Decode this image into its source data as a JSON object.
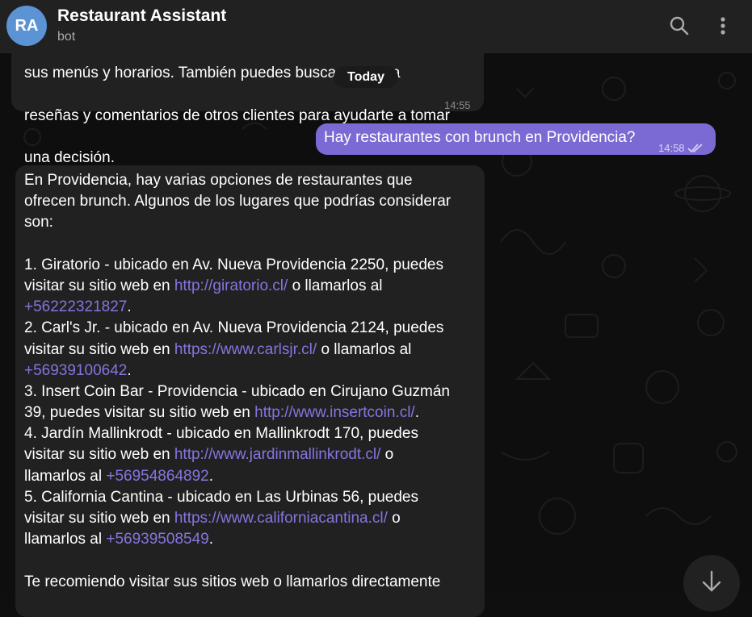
{
  "header": {
    "avatar_initials": "RA",
    "title": "Restaurant Assistant",
    "subtitle": "bot",
    "search_icon": "search-icon",
    "menu_icon": "more-vertical-icon"
  },
  "date_separator": "Today",
  "messages": {
    "msg1": {
      "lines": [
        "sus menús y horarios. También puedes buscar en línea",
        "reseñas y comentarios de otros clientes para ayudarte a tomar",
        "una decisión."
      ],
      "time": "14:55"
    },
    "msg2": {
      "text": "Hay restaurantes con brunch en Providencia?",
      "time": "14:58",
      "status_icon": "double-check-icon"
    },
    "msg3": {
      "intro": [
        "En Providencia, hay varias opciones de restaurantes que",
        "ofrecen brunch. Algunos de los lugares que podrías considerar",
        "son:"
      ],
      "items": {
        "i1": {
          "l1": "1. Giratorio - ubicado en Av. Nueva Providencia 2250, puedes",
          "l2a": "visitar su sitio web en ",
          "link": "http://giratorio.cl/",
          "l2b": " o llamarlos al",
          "phone": "+56222321827",
          "l3b": "."
        },
        "i2": {
          "l1": "2. Carl's Jr. - ubicado en Av. Nueva Providencia 2124, puedes",
          "l2a": "visitar su sitio web en ",
          "link": "https://www.carlsjr.cl/",
          "l2b": " o llamarlos al",
          "phone": "+56939100642",
          "l3b": "."
        },
        "i3": {
          "l1": "3. Insert Coin Bar - Providencia - ubicado en Cirujano Guzmán",
          "l2a": "39, puedes visitar su sitio web en ",
          "link": "http://www.insertcoin.cl/",
          "l2b": "."
        },
        "i4": {
          "l1": "4. Jardín Mallinkrodt - ubicado en Mallinkrodt 170, puedes",
          "l2a": "visitar su sitio web en ",
          "link": "http://www.jardinmallinkrodt.cl/",
          "l2b": " o",
          "l3a": "llamarlos al ",
          "phone": "+56954864892",
          "l3b": "."
        },
        "i5": {
          "l1": "5. California Cantina - ubicado en Las Urbinas 56, puedes",
          "l2a": "visitar su sitio web en ",
          "link": "https://www.californiacantina.cl/",
          "l2b": " o",
          "l3a": "llamarlos al ",
          "phone": "+56939508549",
          "l3b": "."
        }
      },
      "outro": "Te recomiendo visitar sus sitios web o llamarlos directamente"
    }
  },
  "scroll_button_icon": "arrow-down-icon",
  "colors": {
    "header_bg": "#212121",
    "incoming_bubble": "#212121",
    "outgoing_bubble": "#7b6ad3",
    "link": "#8774e1",
    "avatar": "#5b93d5"
  }
}
